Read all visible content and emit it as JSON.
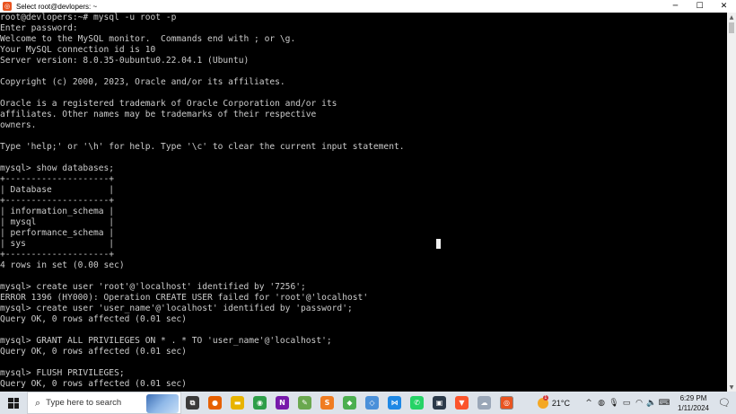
{
  "window": {
    "title": "Select root@devlopers: ~",
    "controls": {
      "minimize": "─",
      "maximize": "☐",
      "close": "✕"
    }
  },
  "terminal": {
    "lines": [
      "root@devlopers:~# mysql -u root -p",
      "Enter password:",
      "Welcome to the MySQL monitor.  Commands end with ; or \\g.",
      "Your MySQL connection id is 10",
      "Server version: 8.0.35-0ubuntu0.22.04.1 (Ubuntu)",
      "",
      "Copyright (c) 2000, 2023, Oracle and/or its affiliates.",
      "",
      "Oracle is a registered trademark of Oracle Corporation and/or its",
      "affiliates. Other names may be trademarks of their respective",
      "owners.",
      "",
      "Type 'help;' or '\\h' for help. Type '\\c' to clear the current input statement.",
      "",
      "mysql> show databases;",
      "+--------------------+",
      "| Database           |",
      "+--------------------+",
      "| information_schema |",
      "| mysql              |",
      "| performance_schema |",
      "| sys                |",
      "+--------------------+",
      "4 rows in set (0.00 sec)",
      "",
      "mysql> create user 'root'@'localhost' identified by '7256';",
      "ERROR 1396 (HY000): Operation CREATE USER failed for 'root'@'localhost'",
      "mysql> create user 'user_name'@'localhost' identified by 'password';",
      "Query OK, 0 rows affected (0.01 sec)",
      "",
      "mysql> GRANT ALL PRIVILEGES ON * . * TO 'user_name'@'localhost';",
      "Query OK, 0 rows affected (0.01 sec)",
      "",
      "mysql> FLUSH PRIVILEGES;",
      "Query OK, 0 rows affected (0.01 sec)"
    ]
  },
  "taskbar": {
    "search_placeholder": "Type here to search",
    "apps": [
      {
        "name": "task-view-icon",
        "glyph": "⧉",
        "color": "#3a3a3a"
      },
      {
        "name": "firefox-icon",
        "glyph": "●",
        "color": "#e66000"
      },
      {
        "name": "file-explorer-icon",
        "glyph": "▬",
        "color": "#e8b400"
      },
      {
        "name": "chrome-icon",
        "glyph": "◉",
        "color": "#2e9e49"
      },
      {
        "name": "onenote-icon",
        "glyph": "N",
        "color": "#7719aa"
      },
      {
        "name": "notepad-plus-icon",
        "glyph": "✎",
        "color": "#6aa84f"
      },
      {
        "name": "sublime-icon",
        "glyph": "S",
        "color": "#f07c21"
      },
      {
        "name": "app-green-icon",
        "glyph": "◆",
        "color": "#4caf50"
      },
      {
        "name": "app-diamond-icon",
        "glyph": "◇",
        "color": "#4a90d9"
      },
      {
        "name": "vscode-icon",
        "glyph": "⋈",
        "color": "#1e88e5"
      },
      {
        "name": "whatsapp-icon",
        "glyph": "✆",
        "color": "#25d366"
      },
      {
        "name": "monitor-app-icon",
        "glyph": "▣",
        "color": "#2b3a4a"
      },
      {
        "name": "brave-icon",
        "glyph": "▼",
        "color": "#fb542b"
      },
      {
        "name": "cloud-app-icon",
        "glyph": "☁",
        "color": "#9aa7b8"
      },
      {
        "name": "ubuntu-terminal-icon",
        "glyph": "◎",
        "color": "#e95420"
      }
    ],
    "weather": {
      "temp": "21°C",
      "badge": "1"
    },
    "tray_icons": [
      {
        "name": "chevron-up-icon",
        "glyph": "^"
      },
      {
        "name": "network-icon",
        "glyph": "◍"
      },
      {
        "name": "microphone-icon",
        "glyph": "🎙"
      },
      {
        "name": "battery-icon",
        "glyph": "▭"
      },
      {
        "name": "wifi-icon",
        "glyph": "◠"
      },
      {
        "name": "volume-icon",
        "glyph": "🔈"
      },
      {
        "name": "keyboard-icon",
        "glyph": "⌨"
      }
    ],
    "clock": {
      "time": "6:29 PM",
      "date": "1/11/2024"
    },
    "notifications_glyph": "🗨"
  }
}
